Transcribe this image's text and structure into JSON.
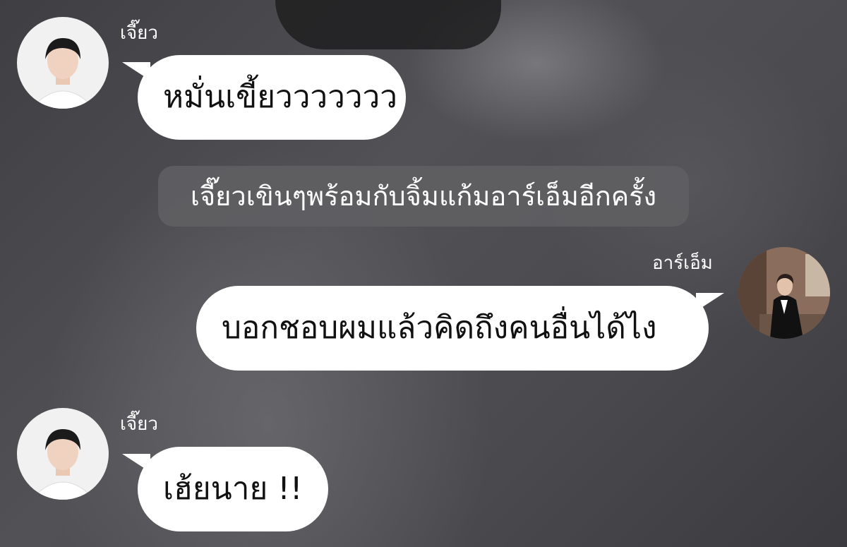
{
  "messages": [
    {
      "sender": "เจี๊ยว",
      "side": "left",
      "text": "หมั่นเขี้ยววววววว"
    },
    {
      "type": "narration",
      "text": "เจี๊ยวเขินๆพร้อมกับจิ้มแก้มอาร์เอ็มอีกครั้ง"
    },
    {
      "sender": "อาร์เอ็ม",
      "side": "right",
      "text": "บอกชอบผมแล้วคิดถึงคนอื่นได้ไง"
    },
    {
      "sender": "เจี๊ยว",
      "side": "left",
      "text": "เฮ้ยนาย !!"
    }
  ],
  "colors": {
    "bubble": "#ffffff",
    "narration_bg": "#5f5f63",
    "background": "#48484c",
    "name_text": "#ffffff"
  }
}
